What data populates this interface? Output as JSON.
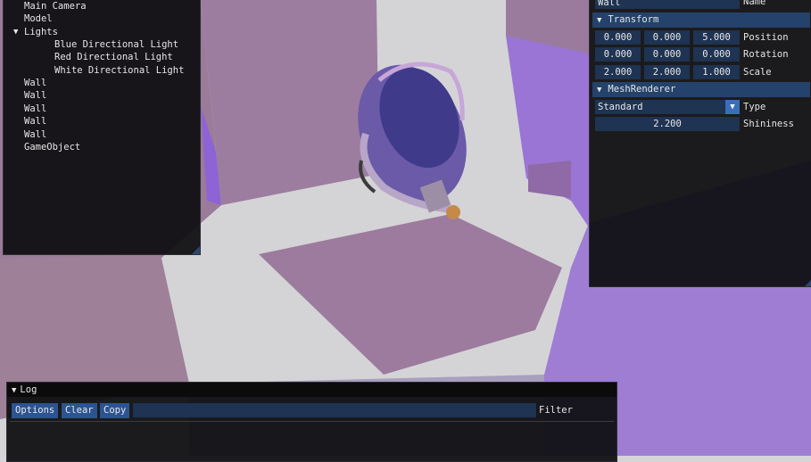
{
  "hierarchy": {
    "items": [
      {
        "label": "Main Camera"
      },
      {
        "label": "Model"
      },
      {
        "label": "Lights",
        "expanded": true
      },
      {
        "label": "Blue Directional Light"
      },
      {
        "label": "Red Directional Light"
      },
      {
        "label": "White Directional Light"
      },
      {
        "label": "Wall"
      },
      {
        "label": "Wall"
      },
      {
        "label": "Wall"
      },
      {
        "label": "Wall"
      },
      {
        "label": "Wall"
      },
      {
        "label": "GameObject"
      }
    ]
  },
  "inspector": {
    "name_value": "Wall",
    "name_label": "Name",
    "transform": {
      "title": "Transform",
      "position": {
        "label": "Position",
        "x": "0.000",
        "y": "0.000",
        "z": "5.000"
      },
      "rotation": {
        "label": "Rotation",
        "x": "0.000",
        "y": "0.000",
        "z": "0.000"
      },
      "scale": {
        "label": "Scale",
        "x": "2.000",
        "y": "2.000",
        "z": "1.000"
      }
    },
    "mesh_renderer": {
      "title": "MeshRenderer",
      "type_value": "Standard",
      "type_label": "Type",
      "shininess_value": "2.200",
      "shininess_label": "Shininess"
    }
  },
  "log": {
    "title": "Log",
    "options_label": "Options",
    "clear_label": "Clear",
    "copy_label": "Copy",
    "filter_value": "",
    "filter_label": "Filter"
  },
  "colors": {
    "wall_purple": "#9b78a0",
    "floor_white": "#d6d6d8",
    "violet_light": "#9f7fd4",
    "field_bg": "#1f3352",
    "header_bg": "#24426b",
    "button_bg": "#2b5490"
  },
  "icons": [
    "expanded-arrow-icon",
    "combo-arrow-icon",
    "resize-grip-icon"
  ]
}
